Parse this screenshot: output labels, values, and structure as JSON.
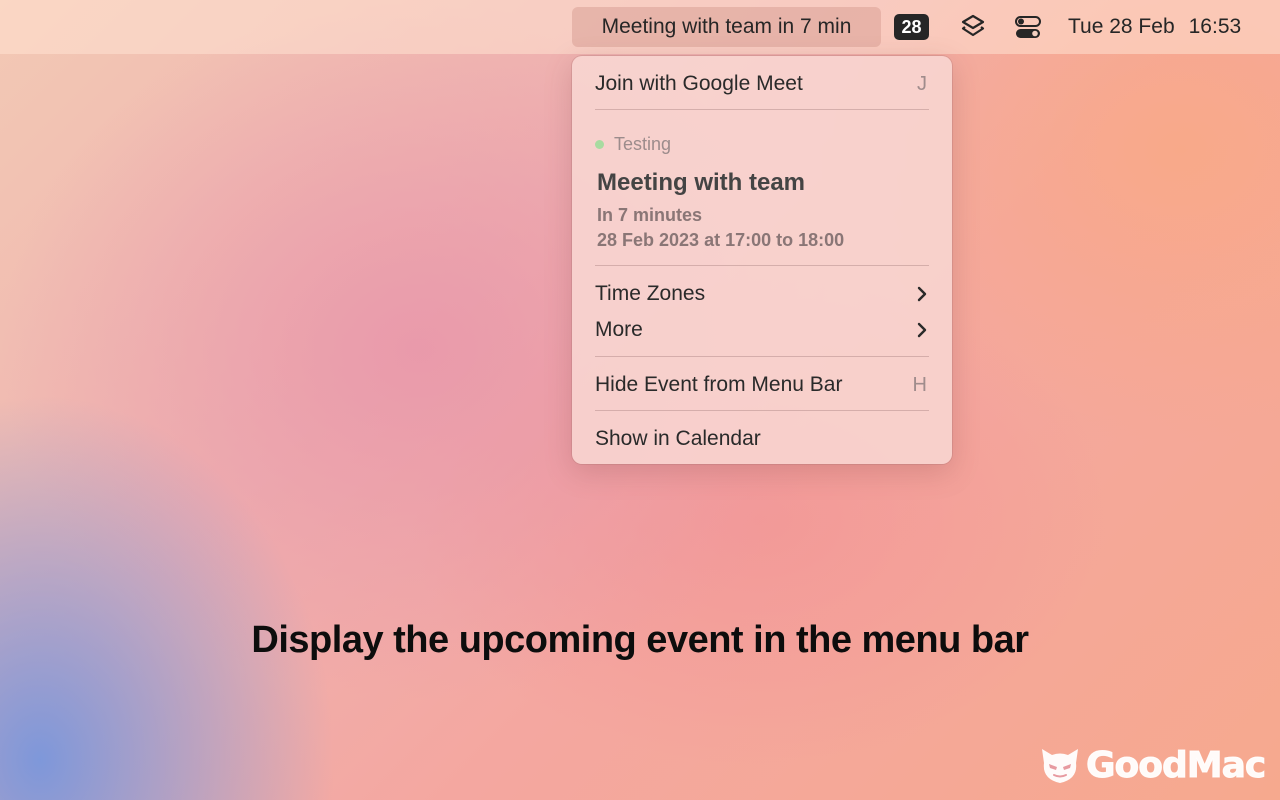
{
  "menubar": {
    "event_label": "Meeting with team in 7 min",
    "calendar_day_badge": "28",
    "date": "Tue 28 Feb",
    "time": "16:53",
    "icons": [
      "calendar-badge-icon",
      "layers-icon",
      "control-center-icon"
    ]
  },
  "menu": {
    "join": {
      "label": "Join with Google Meet",
      "shortcut": "J"
    },
    "calendar_name": "Testing",
    "calendar_color": "#a8dba0",
    "event_title": "Meeting with team",
    "event_relative": "In 7 minutes",
    "event_time": "28 Feb 2023 at 17:00 to 18:00",
    "time_zones": {
      "label": "Time Zones"
    },
    "more": {
      "label": "More"
    },
    "hide_event": {
      "label": "Hide Event from Menu Bar",
      "shortcut": "H"
    },
    "show_in_calendar": {
      "label": "Show in Calendar"
    }
  },
  "caption": "Display the upcoming event in the menu bar",
  "watermark": {
    "brand": "GoodMac"
  }
}
